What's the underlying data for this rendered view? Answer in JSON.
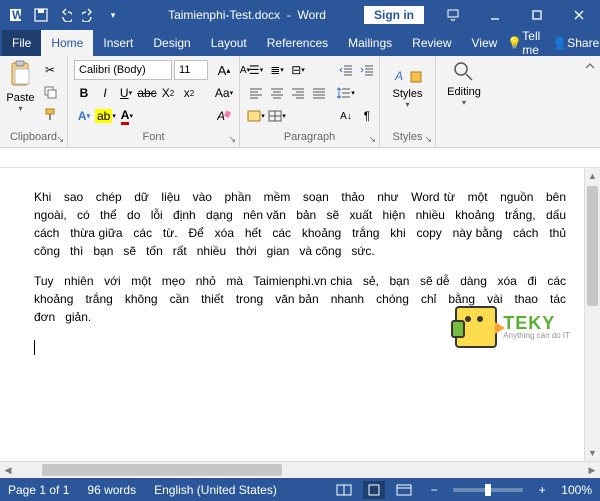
{
  "title_doc": "Taimienphi-Test.docx",
  "title_app": "Word",
  "signin": "Sign in",
  "tabs": {
    "file": "File",
    "home": "Home",
    "insert": "Insert",
    "design": "Design",
    "layout": "Layout",
    "references": "References",
    "mailings": "Mailings",
    "review": "Review",
    "view": "View",
    "tellme": "Tell me",
    "share": "Share"
  },
  "ribbon": {
    "clipboard": {
      "label": "Clipboard",
      "paste": "Paste"
    },
    "font": {
      "label": "Font",
      "family": "Calibri (Body)",
      "size": "11"
    },
    "paragraph": {
      "label": "Paragraph"
    },
    "styles": {
      "label": "Styles",
      "btn": "Styles"
    },
    "editing": {
      "label": "",
      "btn": "Editing"
    }
  },
  "document": {
    "p1": "Khi   sao   chép   dữ   liệu   vào   phần   mềm   soạn   thảo   như   Word từ   một   nguồn   bên   ngoài,   có   thể   do   lỗi   định   dạng   nên văn   bản   sẽ   xuất   hiện   nhiều   khoảng   trắng,   dấu   cách   thừa giữa   các   từ.   Để   xóa   hết   các   khoảng   trắng   khi   copy   này bằng   cách   thủ   công   thì   bạn   sẽ   tốn   rất   nhiều   thời   gian   và công   sức.",
    "p2": "Tuy   nhiên   với   một   mẹo   nhỏ   mà   Taimienphi.vn chia   sẻ,   bạn   sẽ dễ   dàng   xóa   đi   các   khoảng   trắng   không   cần   thiết   trong   văn bản   nhanh   chóng   chỉ   bằng   vài   thao   tác   đơn   giản."
  },
  "status": {
    "page": "Page 1 of 1",
    "words": "96 words",
    "lang": "English (United States)",
    "zoom": "100%"
  },
  "watermark": {
    "brand": "TEKY",
    "tag": "Anything can do IT"
  }
}
